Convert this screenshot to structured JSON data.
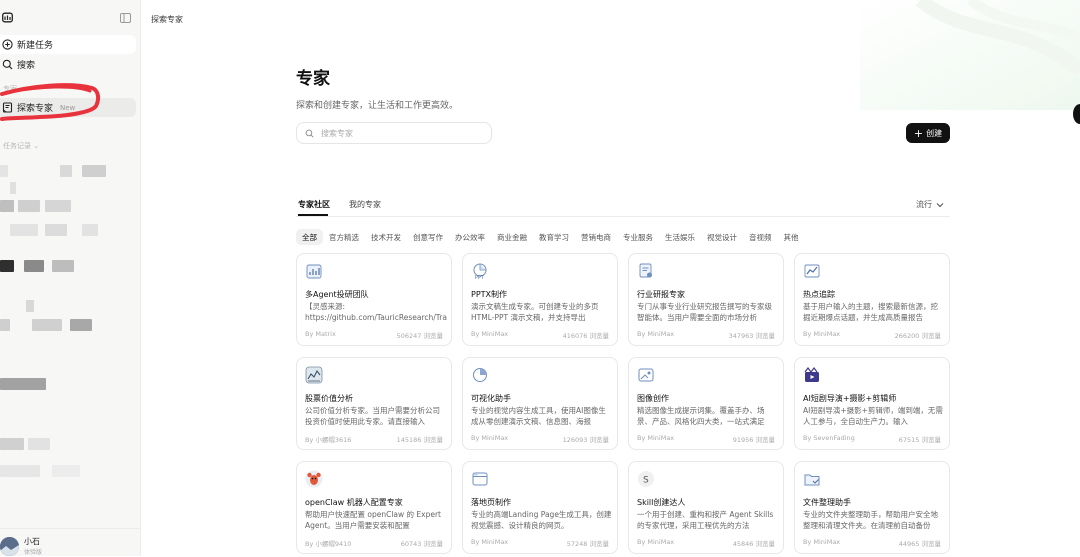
{
  "sidebar": {
    "new_task": "新建任务",
    "search": "搜索",
    "faded_label": "专家",
    "experts": "探索专家",
    "experts_badge": "New",
    "history_label": "任务记录",
    "user_name": "小石",
    "user_sub": "体验版"
  },
  "topbar": {
    "breadcrumb": "探索专家"
  },
  "header": {
    "title": "专家",
    "subtitle": "探索和创建专家，让生活和工作更高效。",
    "search_placeholder": "搜索专家",
    "create_label": "创建"
  },
  "tabs": [
    {
      "label": "专家社区",
      "active": true
    },
    {
      "label": "我的专家",
      "active": false
    }
  ],
  "sort_label": "流行",
  "categories": [
    "全部",
    "官方精选",
    "技术开发",
    "创意写作",
    "办公效率",
    "商业金融",
    "教育学习",
    "营销电商",
    "专业服务",
    "生活娱乐",
    "视觉设计",
    "音视频",
    "其他"
  ],
  "cards": [
    {
      "icon": "chart-team-icon",
      "title": "多Agent投研团队",
      "desc": "【灵感来源: https://github.com/TauricResearch/TradingAgents】",
      "author": "By Matrix",
      "views": "506247 浏览量"
    },
    {
      "icon": "ppt-icon",
      "title": "PPTX制作",
      "desc": "演示文稿生成专家。可创建专业的多页 HTML-PPT 演示文稿，并支持导出",
      "author": "By MiniMax",
      "views": "416076 浏览量"
    },
    {
      "icon": "report-icon",
      "title": "行业研报专家",
      "desc": "专门从事专业行业研究报告撰写的专家级智能体。当用户需要全面的市场分析",
      "author": "By MiniMax",
      "views": "347963 浏览量"
    },
    {
      "icon": "trend-icon",
      "title": "热点追踪",
      "desc": "基于用户输入的主题，搜索最新信源，挖掘近期爆点话题，并生成高质量报告",
      "author": "By MiniMax",
      "views": "266200 浏览量"
    },
    {
      "icon": "stock-icon",
      "title": "股票价值分析",
      "desc": "公司价值分析专家。当用户需要分析公司投资价值时使用此专家。请直接输入",
      "author": "By 小螺帽3616",
      "views": "145186 浏览量"
    },
    {
      "icon": "pie-chart-icon",
      "title": "可视化助手",
      "desc": "专业的视觉内容生成工具，使用AI图像生成从零创建演示文稿、信息图、海报",
      "author": "By MiniMax",
      "views": "126093 浏览量"
    },
    {
      "icon": "image-icon",
      "title": "图像创作",
      "desc": "精选图像生成提示词集。覆盖手办、场景、产品、风格化四大类，一站式满足",
      "author": "By MiniMax",
      "views": "91956 浏览量"
    },
    {
      "icon": "video-icon",
      "title": "AI短剧导演+摄影+剪辑师",
      "desc": "AI短剧导演+摄影+剪辑师，端到端，无需人工参与，全自动生产力。输入",
      "author": "By SevenFading",
      "views": "67515 浏览量"
    },
    {
      "icon": "lobster-icon",
      "title": "openClaw 机器人配置专家",
      "desc": "帮助用户快速配置 openClaw 的 Expert Agent。当用户需要安装和配置",
      "author": "By 小螺帽9410",
      "views": "60743 浏览量"
    },
    {
      "icon": "browser-icon",
      "title": "落地页制作",
      "desc": "专业的高端Landing Page生成工具，创建视觉震撼、设计精良的网页。",
      "author": "By MiniMax",
      "views": "57248 浏览量"
    },
    {
      "icon": "s-letter-icon",
      "title": "Skill创建达人",
      "desc": "一个用于创建、重构和按产 Agent Skills 的专家代理，采用工程优先的方法",
      "author": "By MiniMax",
      "views": "45846 浏览量"
    },
    {
      "icon": "folder-icon",
      "title": "文件整理助手",
      "desc": "专业的文件夹整理助手，帮助用户安全地整理和清理文件夹。在清理前自动备份",
      "author": "By MiniMax",
      "views": "44965 浏览量"
    }
  ],
  "colors": {
    "accent": "#111111",
    "annotation": "#e8323c",
    "sidebar_bg": "#f7f7f6"
  }
}
